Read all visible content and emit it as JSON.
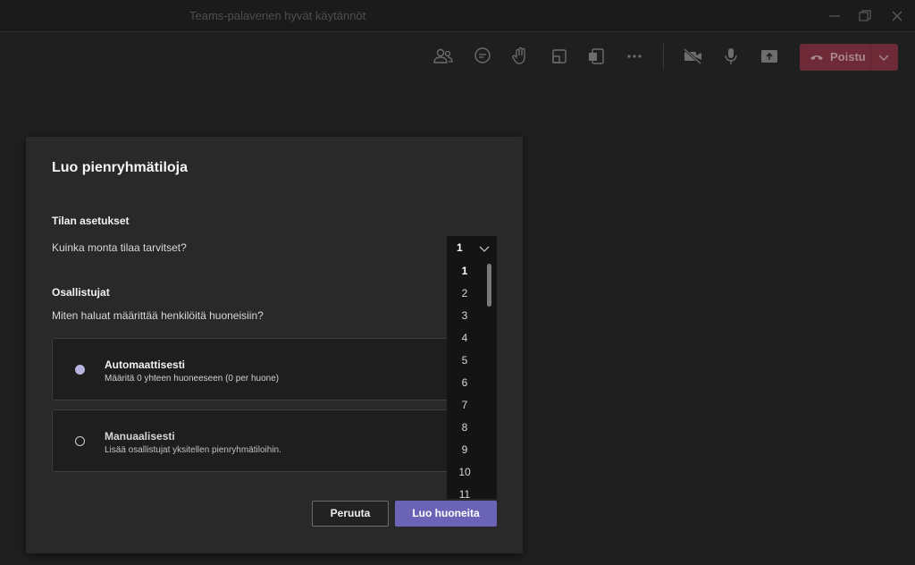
{
  "window": {
    "title": "Teams-palaverien hyvät käytännöt"
  },
  "toolbar": {
    "leave_label": "Poistu",
    "icons": [
      "participants-icon",
      "chat-icon",
      "raise-hand-icon",
      "breakout-rooms-icon",
      "apps-icon",
      "more-icon",
      "camera-off-icon",
      "microphone-icon",
      "share-icon"
    ]
  },
  "dialog": {
    "title": "Luo pienryhmätiloja",
    "room_settings": {
      "heading": "Tilan asetukset",
      "question": "Kuinka monta tilaa tarvitset?",
      "selected": "1",
      "options": [
        "1",
        "2",
        "3",
        "4",
        "5",
        "6",
        "7",
        "8",
        "9",
        "10",
        "11"
      ]
    },
    "participants": {
      "heading": "Osallistujat",
      "question": "Miten haluat määrittää henkilöitä huoneisiin?",
      "auto": {
        "title": "Automaattisesti",
        "subtitle": "Määritä 0 yhteen huoneeseen (0 per huone)",
        "checked": true
      },
      "manual": {
        "title": "Manuaalisesti",
        "subtitle": "Lisää osallistujat yksitellen pienryhmätiloihin.",
        "checked": false
      }
    },
    "buttons": {
      "cancel": "Peruuta",
      "create": "Luo huoneita"
    }
  },
  "colors": {
    "accent": "#6b64b6",
    "leave": "#6e2a36",
    "background": "#1f1f1f"
  }
}
